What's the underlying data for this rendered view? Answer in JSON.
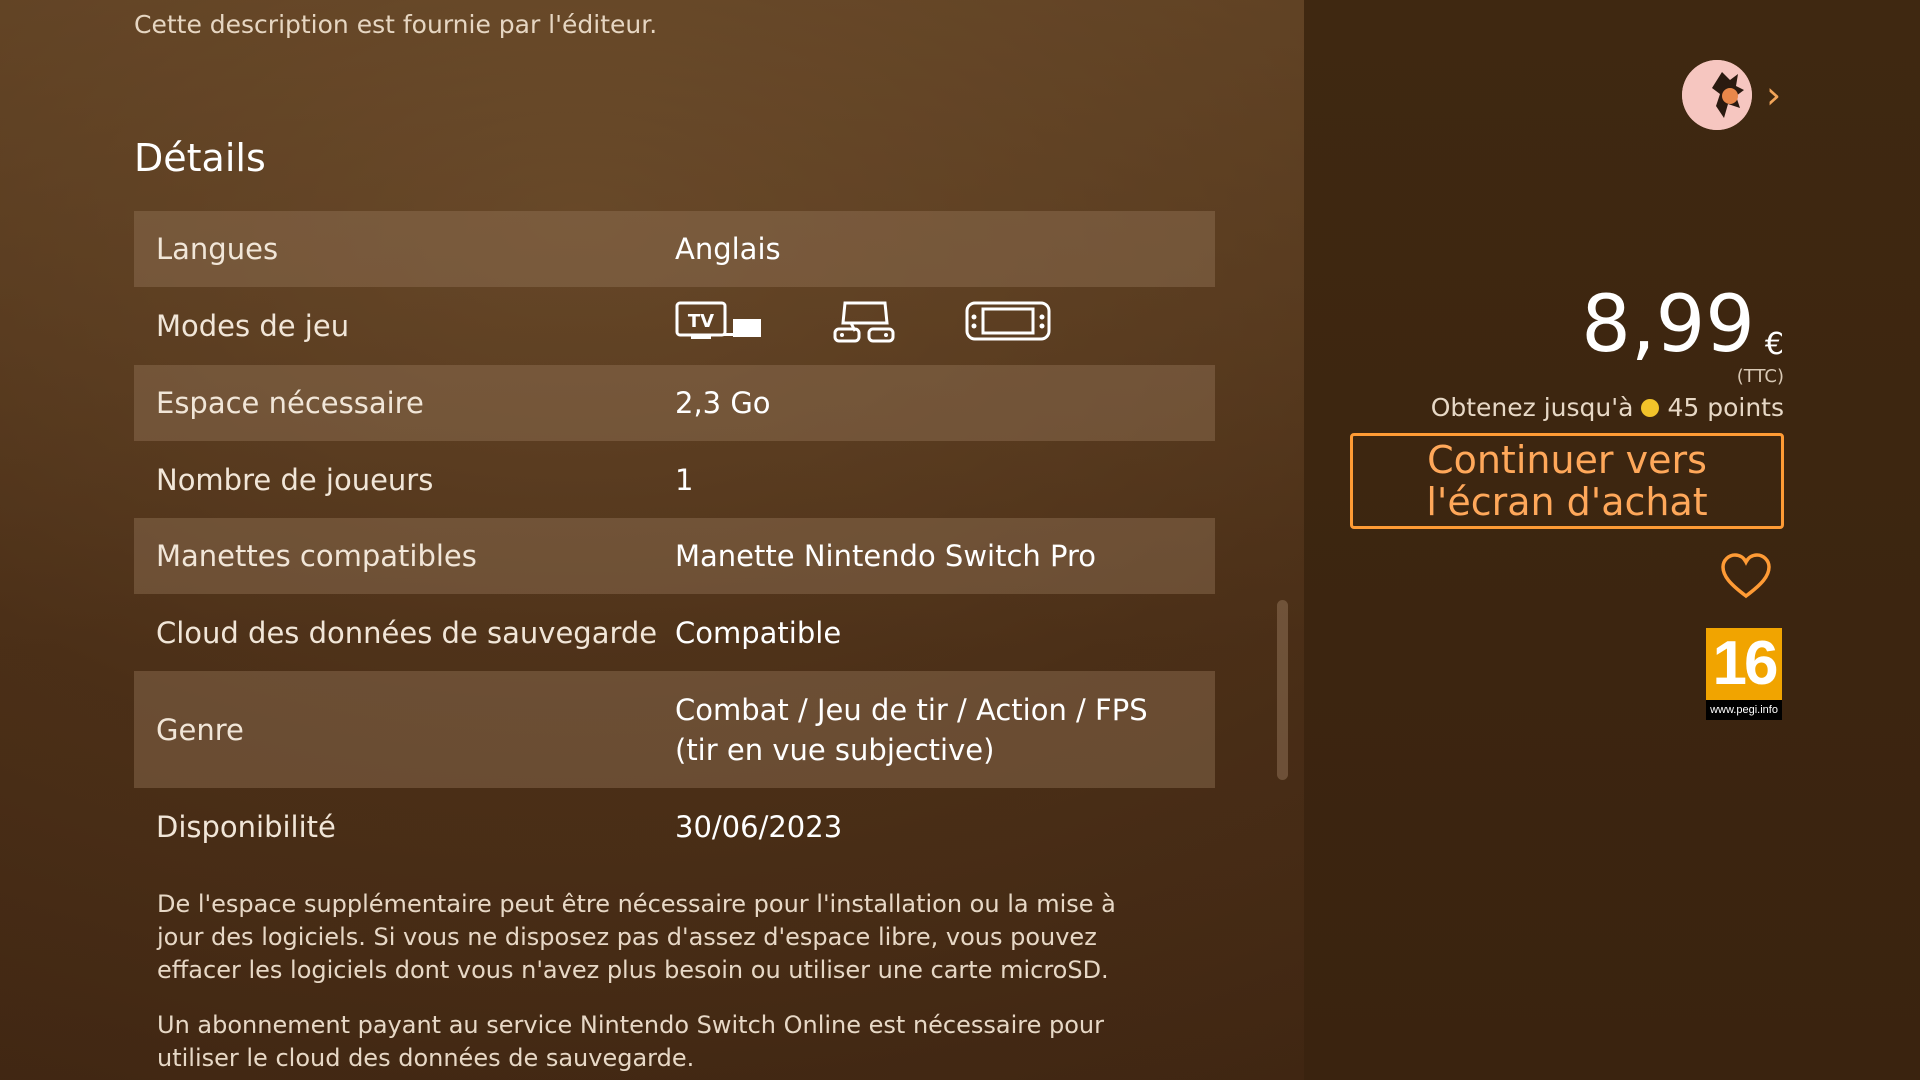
{
  "publisher_note": "Cette description est fournie par l'éditeur.",
  "details": {
    "title": "Détails",
    "rows": [
      {
        "label": "Langues",
        "value": "Anglais"
      },
      {
        "label": "Modes de jeu",
        "icons": [
          "tv-mode-icon",
          "tabletop-mode-icon",
          "handheld-mode-icon"
        ]
      },
      {
        "label": "Espace nécessaire",
        "value": "2,3 Go"
      },
      {
        "label": "Nombre de joueurs",
        "value": "1"
      },
      {
        "label": "Manettes compatibles",
        "value": "Manette Nintendo Switch Pro"
      },
      {
        "label": "Cloud des données de sauvegarde",
        "value": "Compatible"
      },
      {
        "label": "Genre",
        "value_line1": "Combat / Jeu de tir / Action / FPS",
        "value_line2": "(tir en vue subjective)"
      },
      {
        "label": "Disponibilité",
        "value": "30/06/2023"
      }
    ]
  },
  "footnotes": [
    "De l'espace supplémentaire peut être nécessaire pour l'installation ou la mise à jour des logiciels. Si vous ne disposez pas d'assez d'espace libre, vous pouvez effacer les logiciels dont vous n'avez plus besoin ou utiliser une carte microSD.",
    "Un abonnement payant au service Nintendo Switch Online est nécessaire pour utiliser le cloud des données de sauvegarde."
  ],
  "purchase": {
    "price": "8,99",
    "currency": "€",
    "tax_note": "(TTC)",
    "points_prefix": "Obtenez jusqu'à",
    "points_value": "45 points",
    "buy_label": "Continuer vers l'écran d'achat"
  },
  "rating": {
    "number": "16",
    "site": "www.pegi.info",
    "color": "#f1a400"
  },
  "colors": {
    "accent": "#ff9b35",
    "coin": "#f2c32a"
  }
}
